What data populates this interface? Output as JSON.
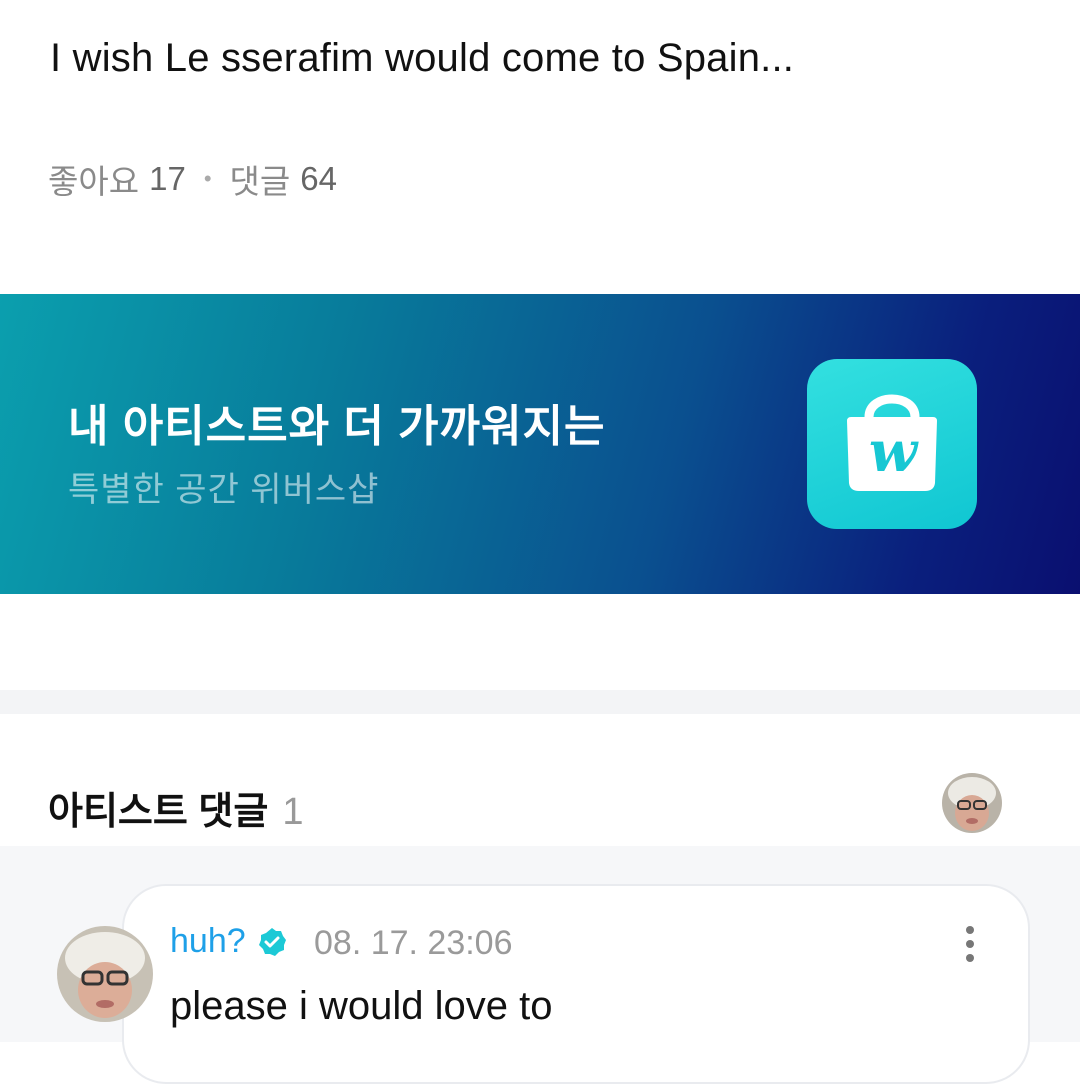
{
  "post": {
    "body": "I wish Le sserafim would come to Spain...",
    "likes_label": "좋아요",
    "likes_count": "17",
    "separator": "•",
    "comments_label": "댓글",
    "comments_count": "64"
  },
  "banner": {
    "title": "내 아티스트와 더 가까워지는",
    "subtitle": "특별한 공간 위버스샵",
    "icon": "weverse-shop-bag-icon",
    "icon_letter": "w",
    "colors": {
      "start": "#0b9fae",
      "end": "#0a0f70",
      "icon": "#1ccfd8"
    }
  },
  "artist_comments": {
    "title": "아티스트 댓글",
    "count": "1",
    "items": [
      {
        "author": "huh?",
        "verified": true,
        "timestamp": "08. 17. 23:06",
        "text": "please i would love to"
      }
    ]
  },
  "colors": {
    "author": "#1ea0e8",
    "verified_badge": "#1cc9d6",
    "muted_text": "#8a8a8a"
  }
}
